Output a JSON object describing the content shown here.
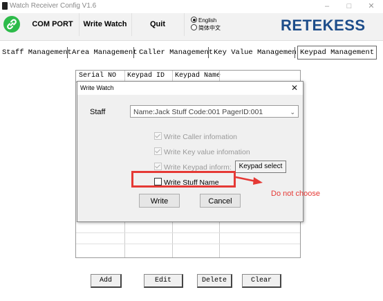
{
  "window": {
    "title": "Watch Receiver Config V1.6",
    "minimize_glyph": "–",
    "maximize_glyph": "□",
    "close_glyph": "✕"
  },
  "toolbar": {
    "link_icon": "link-icon",
    "com_port_label": "COM PORT",
    "write_watch_label": "Write Watch",
    "quit_label": "Quit",
    "language": {
      "options": [
        "English",
        "简体中文"
      ],
      "selected": "English"
    },
    "logo_text": "RETEKESS",
    "logo_color": "#1d4d8a"
  },
  "tabs": [
    {
      "label": "Staff Management"
    },
    {
      "label": "Area Management"
    },
    {
      "label": "Caller Management"
    },
    {
      "label": "Key Value Management"
    },
    {
      "label": "Keypad Management"
    }
  ],
  "active_tab": "Keypad Management",
  "table": {
    "columns": [
      "Serial NO",
      "Keypad ID",
      "Keypad Name"
    ],
    "rows": []
  },
  "bottom_buttons": {
    "add": "Add",
    "edit": "Edit",
    "delete": "Delete",
    "clear": "Clear"
  },
  "dialog": {
    "title": "Write Watch",
    "close_glyph": "✕",
    "staff_label": "Staff",
    "staff_value": "Name:Jack Stuff Code:001 PagerID:001",
    "options": [
      {
        "label": "Write Caller infomation",
        "checked": true,
        "enabled": false
      },
      {
        "label": "Write Key value infomation",
        "checked": true,
        "enabled": false
      },
      {
        "label": "Write Keypad inform:",
        "checked": true,
        "enabled": false
      },
      {
        "label": "Write Stuff Name",
        "checked": false,
        "enabled": true
      }
    ],
    "keypad_select_label": "Keypad select",
    "write_label": "Write",
    "cancel_label": "Cancel"
  },
  "annotation": {
    "text": "Do not choose",
    "color": "#e53935"
  }
}
